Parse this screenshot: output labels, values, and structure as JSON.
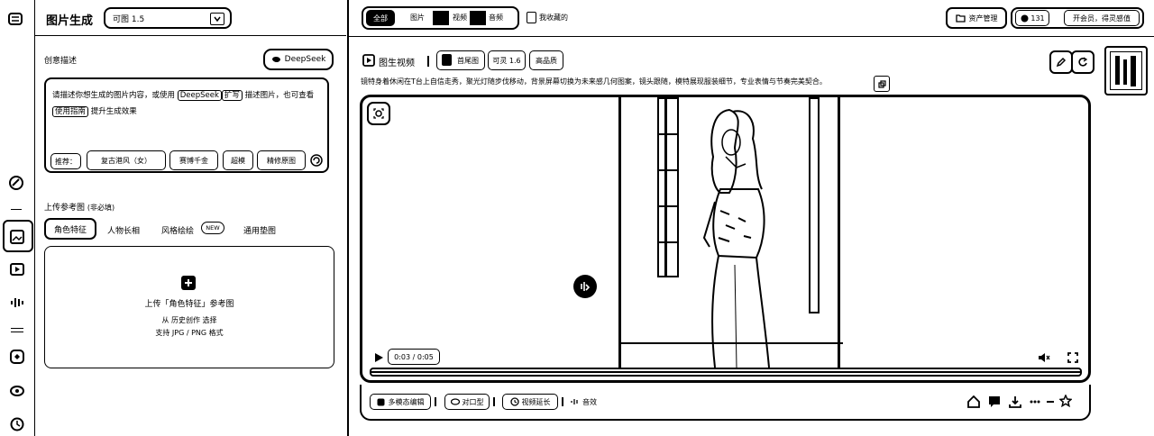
{
  "left": {
    "title": "图片生成",
    "model_select": "可图 1.5",
    "desc_label": "创意描述",
    "deepseek_btn": "DeepSeek",
    "desc_placeholder_1": "请描述你想生成的图片内容，或使用",
    "desc_link": "DeepSeek",
    "desc_placeholder_2": "扩写",
    "desc_placeholder_3": "描述图片，也可查看",
    "desc_link_2": "使用指南",
    "desc_placeholder_4": "提升生成效果",
    "rec_label": "推荐：",
    "rec_tags": [
      "复古港风（女）",
      "赛博千金",
      "超模",
      "精修原图"
    ],
    "upload_label": "上传参考图",
    "upload_hint": "(非必填)",
    "ref_tabs": [
      "角色特征",
      "人物长相",
      "风格绘绘",
      "通用垫图"
    ],
    "new_badge": "NEW",
    "upload_title": "上传「角色特征」参考图",
    "upload_from": "从 历史创作 选择",
    "upload_support": "支持 JPG / PNG 格式"
  },
  "topbar": {
    "filters": [
      "全部",
      "图片",
      "视频",
      "音频"
    ],
    "favorites": "我收藏的",
    "asset_btn": "资产管理",
    "points": "131",
    "vip_text": "开会员，得灵感值"
  },
  "card": {
    "type_label": "图生视频",
    "tags": [
      "首尾图",
      "可灵 1.6",
      "高品质"
    ],
    "prompt": "镜特身着休闲在T台上自信走秀，聚光灯随步伐移动，背景屏幕切换为未来感几何图案，镜头跟随，模特展现服装细节，专业表情与节奏完美契合。",
    "time": "0:03 / 0:05",
    "actions": [
      "多模态编辑",
      "对口型",
      "视频延长",
      "音效"
    ]
  }
}
